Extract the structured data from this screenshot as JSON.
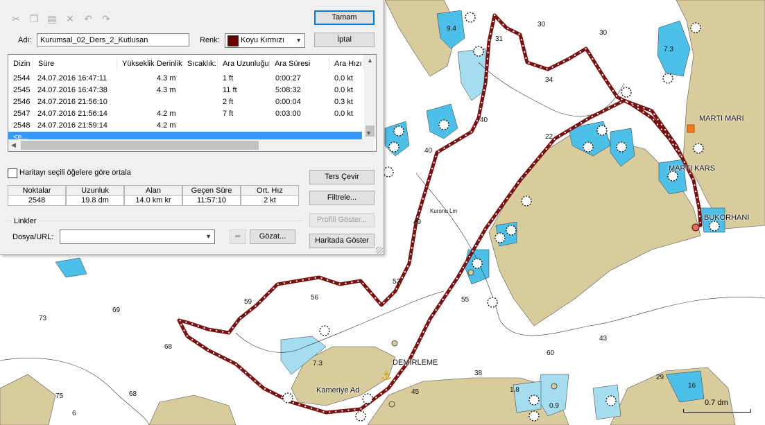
{
  "colors": {
    "sea_light": "#a4dcf0",
    "sea_blue": "#4cc0e8",
    "land": "#d8cc9c",
    "track": "#7a1010",
    "selection": "#3399ff"
  },
  "dialog": {
    "toolbar_icons": [
      "cut-icon",
      "copy-icon",
      "paste-icon",
      "delete-icon",
      "undo-icon",
      "redo-icon"
    ],
    "name_label": "Adı:",
    "name_value": "Kurumsal_02_Ders_2_Kutlusan",
    "color_label": "Renk:",
    "color_value": "Koyu Kırmızı",
    "color_hex": "#6b0000",
    "buttons": {
      "ok": "Tamam",
      "cancel": "İptal",
      "reverse": "Ters Çevir",
      "filter": "Filtrele...",
      "profile": "Profili Göster...",
      "show_on_map": "Haritada Göster",
      "browse": "Gözat..."
    },
    "table": {
      "headers": [
        "Dizin",
        "Süre",
        "Yükseklik",
        "Derinlik",
        "Sıcaklık:",
        "Ara Uzunluğu",
        "Ara Süresi",
        "Ara Hızı"
      ],
      "rows": [
        [
          "2544",
          "24.07.2016 16:47:11",
          "",
          "4.3 m",
          "",
          "1 ft",
          "0:00:27",
          "0.0 kt"
        ],
        [
          "2545",
          "24.07.2016 16:47:38",
          "",
          "4.3 m",
          "",
          "11 ft",
          "5:08:32",
          "0.0 kt"
        ],
        [
          "2546",
          "24.07.2016 21:56:10",
          "",
          "",
          "",
          "2 ft",
          "0:00:04",
          "0.3 kt"
        ],
        [
          "2547",
          "24.07.2016 21:56:14",
          "",
          "4.2 m",
          "",
          "7 ft",
          "0:03:00",
          "0.0 kt"
        ],
        [
          "2548",
          "24.07.2016 21:59:14",
          "",
          "4.2 m",
          "",
          "",
          "",
          ""
        ]
      ],
      "selected_row": "<e..."
    },
    "center_checkbox_label": "Haritayı seçili öğelere göre ortala",
    "stats": {
      "headers": [
        "Noktalar",
        "Uzunluk",
        "Alan",
        "Geçen Süre",
        "Ort. Hız"
      ],
      "values": [
        "2548",
        "19.8 dm",
        "14.0 km kr",
        "11:57:10",
        "2 kt"
      ]
    },
    "links": {
      "group_label": "Linkler",
      "file_label": "Dosya/URL:",
      "file_value": ""
    }
  },
  "map": {
    "labels": {
      "marti_mari": "MARTI MARI",
      "marti_kars": "MARTI KARS",
      "bukorhani": "BUKORHANI",
      "demirleme": "DEMIRLEME",
      "kameriye": "Kameriye Ad",
      "kuronu": "Kuronu Lm"
    },
    "depths": [
      "9.4",
      "30",
      "30",
      "7.3",
      "34",
      "40",
      "31",
      "40",
      "22",
      "49",
      "53",
      "56",
      "59",
      "55",
      "69",
      "73",
      "68",
      "43",
      "60",
      "38",
      "45",
      "7.3",
      "29",
      "16",
      "1.8",
      "0.9",
      "75",
      "68",
      "6"
    ],
    "scale_label": "0.7 dm"
  }
}
